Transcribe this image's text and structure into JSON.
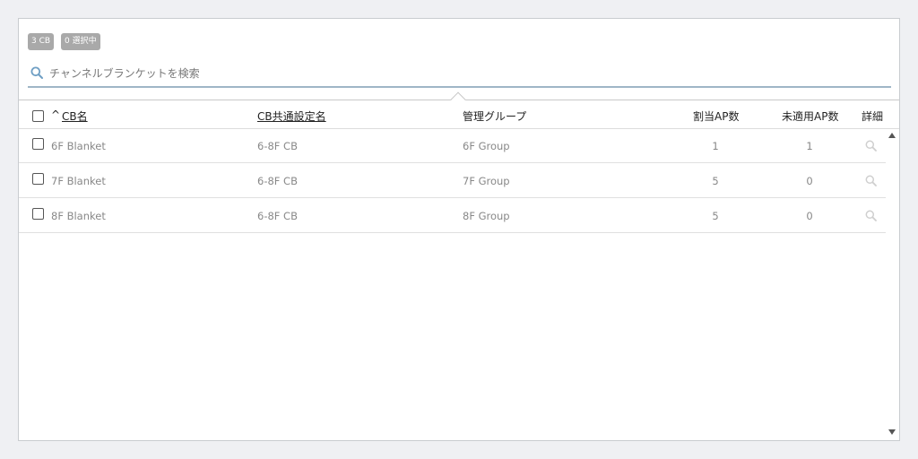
{
  "badges": {
    "count": "3 CB",
    "selected": "0 選択中"
  },
  "search": {
    "placeholder": "チャンネルブランケットを検索"
  },
  "table": {
    "headers": {
      "sort_arrow": "^",
      "cb_name": "CB名",
      "common_setting": "CB共通設定名",
      "group": "管理グループ",
      "assigned_ap": "割当AP数",
      "unapplied_ap": "未適用AP数",
      "detail": "詳細"
    },
    "rows": [
      {
        "cb_name": "6F Blanket",
        "common_setting": "6-8F CB",
        "group": "6F Group",
        "assigned_ap": "1",
        "unapplied_ap": "1"
      },
      {
        "cb_name": "7F Blanket",
        "common_setting": "6-8F CB",
        "group": "7F Group",
        "assigned_ap": "5",
        "unapplied_ap": "0"
      },
      {
        "cb_name": "8F Blanket",
        "common_setting": "6-8F CB",
        "group": "8F Group",
        "assigned_ap": "5",
        "unapplied_ap": "0"
      }
    ]
  },
  "icons": {
    "search": "search-icon",
    "detail": "magnifier-icon"
  },
  "colors": {
    "badge_bg": "#a9a9a9",
    "search_underline": "#9fb6c7",
    "icon_blue": "#6f9fc4"
  }
}
